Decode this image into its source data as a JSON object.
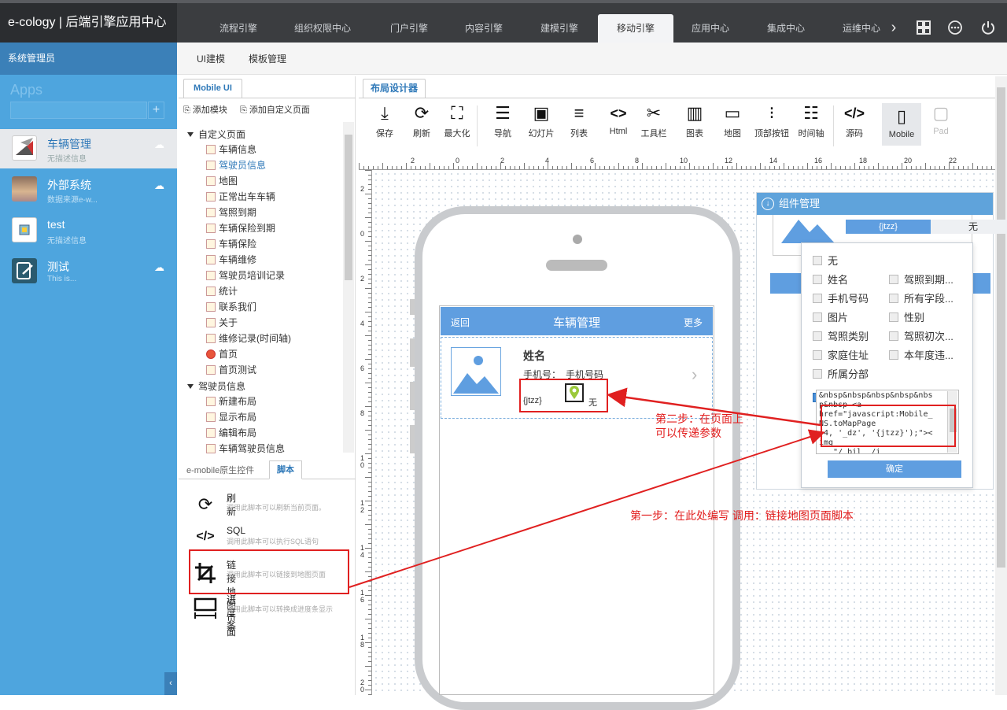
{
  "topbar": {
    "brand": "e-cology | 后端引擎应用中心",
    "tabs": [
      "流程引擎",
      "组织权限中心",
      "门户引擎",
      "内容引擎",
      "建模引擎",
      "移动引擎",
      "应用中心",
      "集成中心",
      "运维中心"
    ],
    "active_tab": "移动引擎",
    "icons": [
      "chevron-right-icon",
      "grid-icon",
      "more-icon",
      "power-icon"
    ]
  },
  "leftnav": {
    "user": "系统管理员",
    "apps_label": "Apps",
    "apps": [
      {
        "name": "车辆管理",
        "desc": "无描述信息",
        "selected": true
      },
      {
        "name": "外部系统",
        "desc": "数据来源e-w..."
      },
      {
        "name": "test",
        "desc": "无描述信息"
      },
      {
        "name": "测试",
        "desc": "This is..."
      }
    ]
  },
  "subtabs": [
    "UI建模",
    "模板管理"
  ],
  "lpanel": {
    "tab": "Mobile UI",
    "add_module": "添加模块",
    "add_page": "添加自定义页面",
    "tree": {
      "group1": "自定义页面",
      "items1": [
        "车辆信息",
        "驾驶员信息",
        "地图",
        "正常出车车辆",
        "驾照到期",
        "车辆保险到期",
        "车辆保险",
        "车辆维修",
        "驾驶员培训记录",
        "统计",
        "联系我们",
        "关于",
        "维修记录(时间轴)",
        "首页",
        "首页测试"
      ],
      "group2": "驾驶员信息",
      "items2": [
        "新建布局",
        "显示布局",
        "编辑布局",
        "车辆驾驶员信息"
      ]
    },
    "bottom_tabs": [
      "e-mobile原生控件",
      "脚本"
    ],
    "scripts": [
      {
        "icon": "refresh-icon",
        "title": "刷新",
        "desc": "调用此脚本可以刷新当前页面。"
      },
      {
        "icon": "code-icon",
        "title": "SQL",
        "desc": "调用此脚本可以执行SQL语句"
      },
      {
        "icon": "crop-icon",
        "title": "链接地图页面",
        "desc": "调用此脚本可以链接到地图页面"
      },
      {
        "icon": "progress-icon",
        "title": "进度条",
        "desc": "调用此脚本可以转换成进度条显示"
      }
    ]
  },
  "designer": {
    "tab": "布局设计器",
    "toolbar": [
      "保存",
      "刷新",
      "最大化",
      "导航",
      "幻灯片",
      "列表",
      "Html",
      "工具栏",
      "图表",
      "地图",
      "顶部按钮",
      "时间轴",
      "源码",
      "Mobile",
      "Pad"
    ],
    "ruler_h": [
      "2",
      "0",
      "2",
      "4",
      "6",
      "8",
      "10",
      "12",
      "14",
      "16",
      "18",
      "20",
      "22"
    ],
    "ruler_v": [
      "2",
      "0",
      "2",
      "4",
      "6",
      "8",
      "10",
      "12",
      "14",
      "16",
      "18",
      "20"
    ]
  },
  "phone": {
    "back": "返回",
    "title": "车辆管理",
    "more": "更多",
    "name_label": "姓名",
    "phone_label": "手机号：",
    "phone_value": "手机号码",
    "param": "{jtzz}",
    "none": "无"
  },
  "component_manager": {
    "title": "组件管理",
    "param": "{jtzz}",
    "none": "无",
    "options_left": [
      "无",
      "姓名",
      "手机号码",
      "图片",
      "驾照类别",
      "家庭住址",
      "所属分部"
    ],
    "options_right": [
      "驾照到期...",
      "所有字段...",
      "性别",
      "驾照初次...",
      "本年度违..."
    ],
    "code": "&nbsp&nbsp&nbsp&nbsp&nbs\np&nbsp <a\nhref=\"javascript:Mobile_\nNS.toMapPage\n(4, '_dz', '{jtzz}');\"><\nimg\n   \"/ bil  /i",
    "confirm": "确定"
  },
  "annotations": {
    "step1": "第一步：在此处编写 调用：链接地图页面脚本",
    "step2_line1": "第二步：在页面上",
    "step2_line2": "可以传递参数"
  },
  "colors": {
    "accent": "#4ea5de",
    "annotation": "#e02020",
    "header_blue": "#5fa3db"
  }
}
